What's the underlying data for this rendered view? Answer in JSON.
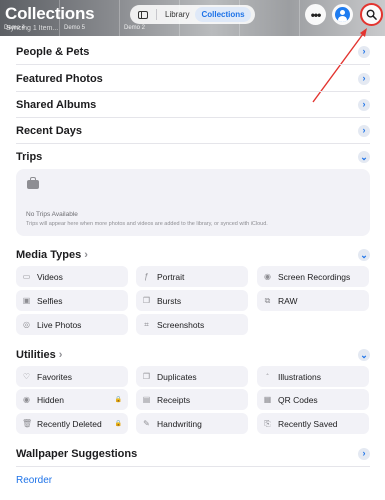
{
  "header": {
    "title": "Collections",
    "syncing": "Syncing 1 Item...",
    "thumbs": [
      "Demo 4",
      "Demo 5",
      "Demo 2",
      "",
      ""
    ],
    "segment": {
      "library": "Library",
      "collections": "Collections"
    },
    "more_label": "•••"
  },
  "sections": {
    "people_pets": "People & Pets",
    "featured_photos": "Featured Photos",
    "shared_albums": "Shared Albums",
    "recent_days": "Recent Days",
    "trips": "Trips",
    "media_types": "Media Types",
    "utilities": "Utilities",
    "wallpaper": "Wallpaper Suggestions"
  },
  "trips_card": {
    "title": "No Trips Available",
    "message": "Trips will appear here when more photos and videos are added to the library, or synced with iCloud."
  },
  "media_types": [
    {
      "label": "Videos",
      "icon": "video-icon"
    },
    {
      "label": "Portrait",
      "icon": "portrait-icon"
    },
    {
      "label": "Screen Recordings",
      "icon": "screen-recording-icon"
    },
    {
      "label": "Selfies",
      "icon": "selfie-icon"
    },
    {
      "label": "Bursts",
      "icon": "burst-icon"
    },
    {
      "label": "RAW",
      "icon": "raw-icon"
    },
    {
      "label": "Live Photos",
      "icon": "live-photo-icon"
    },
    {
      "label": "Screenshots",
      "icon": "screenshot-icon"
    }
  ],
  "utilities": [
    {
      "label": "Favorites",
      "icon": "heart-icon"
    },
    {
      "label": "Duplicates",
      "icon": "duplicate-icon"
    },
    {
      "label": "Illustrations",
      "icon": "illustration-icon"
    },
    {
      "label": "Hidden",
      "icon": "eye-slash-icon",
      "locked": true
    },
    {
      "label": "Receipts",
      "icon": "receipt-icon"
    },
    {
      "label": "QR Codes",
      "icon": "qr-code-icon"
    },
    {
      "label": "Recently Deleted",
      "icon": "trash-icon",
      "locked": true
    },
    {
      "label": "Handwriting",
      "icon": "pencil-icon"
    },
    {
      "label": "Recently Saved",
      "icon": "recently-saved-icon"
    }
  ],
  "lock_glyph": "🔒",
  "reorder": "Reorder",
  "colors": {
    "accent": "#1e73e8",
    "highlight": "#e3342f",
    "tile_bg": "#f2f2f7"
  }
}
